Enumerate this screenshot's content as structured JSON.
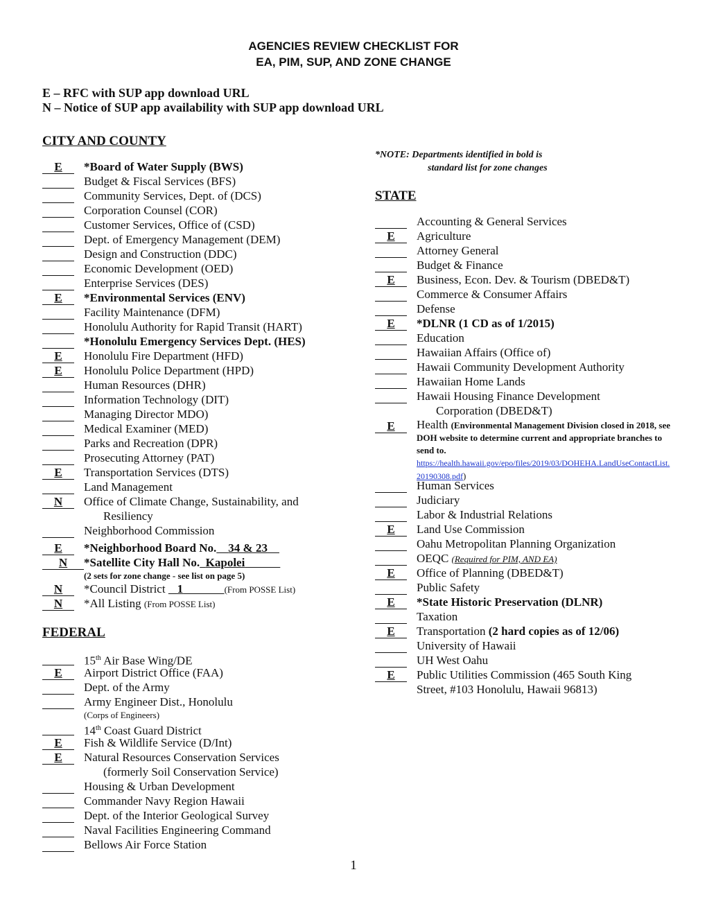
{
  "title": {
    "line1": "AGENCIES REVIEW CHECKLIST FOR",
    "line2": "EA, PIM, SUP, AND ZONE CHANGE"
  },
  "legend": {
    "e": "E – RFC with SUP app download URL",
    "n": "N – Notice of SUP app availability with SUP app download URL"
  },
  "note": {
    "line1": "*NOTE:  Departments identified in bold is",
    "line2": "standard list for zone changes"
  },
  "city_county": {
    "heading": "CITY AND COUNTY",
    "items": [
      {
        "mark": "E",
        "label": "*Board of Water Supply (BWS)",
        "bold": true
      },
      {
        "mark": "",
        "label": "Budget & Fiscal Services (BFS)"
      },
      {
        "mark": "",
        "label": "Community Services, Dept. of (DCS)"
      },
      {
        "mark": "",
        "label": "Corporation Counsel (COR)"
      },
      {
        "mark": "",
        "label": "Customer Services, Office of (CSD)"
      },
      {
        "mark": "",
        "label": "Dept. of Emergency Management (DEM)"
      },
      {
        "mark": "",
        "label": "Design and Construction (DDC)"
      },
      {
        "mark": "",
        "label": "Economic Development (OED)"
      },
      {
        "mark": "",
        "label": "Enterprise Services (DES)"
      },
      {
        "mark": "E",
        "label": "*Environmental Services (ENV)",
        "bold": true
      },
      {
        "mark": "",
        "label": "Facility Maintenance (DFM)"
      },
      {
        "mark": "",
        "label": "Honolulu Authority for Rapid Transit (HART)"
      },
      {
        "mark": "",
        "label": "*Honolulu Emergency Services Dept. (HES)",
        "bold": true
      },
      {
        "mark": "E",
        "label": "Honolulu Fire Department (HFD)"
      },
      {
        "mark": "E",
        "label": "Honolulu Police Department (HPD)"
      },
      {
        "mark": "",
        "label": "Human Resources (DHR)"
      },
      {
        "mark": "",
        "label": "Information Technology (DIT)"
      },
      {
        "mark": "",
        "label": "Managing Director MDO)"
      },
      {
        "mark": "",
        "label": "Medical Examiner (MED)"
      },
      {
        "mark": "",
        "label": "Parks and Recreation (DPR)"
      },
      {
        "mark": "",
        "label": "Prosecuting Attorney (PAT)"
      },
      {
        "mark": "E",
        "label": "Transportation Services (DTS)"
      },
      {
        "mark": "",
        "label": "Land Management"
      },
      {
        "mark": "N",
        "label": "Office of Climate Change, Sustainability, and",
        "cont": "Resiliency"
      },
      {
        "mark": "",
        "label": "Neighborhood Commission"
      }
    ],
    "neighborhood_board": {
      "mark": "E",
      "label": "*Neighborhood Board No.",
      "value": "34 & 23"
    },
    "satellite_city_hall": {
      "mark": "N",
      "label": "*Satellite City Hall No.",
      "value": "Kapolei",
      "note": "(2 sets for zone change - see list on page 5)"
    },
    "council_district": {
      "mark": "N",
      "label": "*Council District",
      "value": "1",
      "suffix": "(From POSSE List)"
    },
    "all_listing": {
      "mark": "N",
      "label": "*All Listing",
      "suffix": "(From POSSE List)"
    }
  },
  "federal": {
    "heading": "FEDERAL",
    "items": [
      {
        "mark": "",
        "label": "15",
        "sup": "th",
        "rest": " Air Base Wing/DE"
      },
      {
        "mark": "E",
        "label": "Airport District Office (FAA)"
      },
      {
        "mark": "",
        "label": "Dept. of the Army"
      },
      {
        "mark": "",
        "label": "Army Engineer Dist., Honolulu",
        "sub": "(Corps of Engineers)"
      },
      {
        "mark": "",
        "label": "14",
        "sup": "th",
        "rest": " Coast Guard District"
      },
      {
        "mark": "E",
        "label": "Fish & Wildlife Service (D/Int)"
      },
      {
        "mark": "E",
        "label": "Natural Resources Conservation Services",
        "cont": "(formerly Soil Conservation Service)"
      },
      {
        "mark": "",
        "label": "Housing & Urban Development"
      },
      {
        "mark": "",
        "label": "Commander Navy Region Hawaii"
      },
      {
        "mark": "",
        "label": "Dept. of the Interior Geological Survey"
      },
      {
        "mark": "",
        "label": "Naval Facilities Engineering Command"
      },
      {
        "mark": "",
        "label": "Bellows Air Force Station"
      }
    ]
  },
  "state": {
    "heading": "STATE",
    "items": [
      {
        "mark": "",
        "label": "Accounting & General Services"
      },
      {
        "mark": "E",
        "label": "Agriculture"
      },
      {
        "mark": "",
        "label": "Attorney General"
      },
      {
        "mark": "",
        "label": "Budget & Finance"
      },
      {
        "mark": "E",
        "label": "Business, Econ. Dev. & Tourism (DBED&T)"
      },
      {
        "mark": "",
        "label": "Commerce & Consumer Affairs"
      },
      {
        "mark": "",
        "label": "Defense"
      },
      {
        "mark": "E",
        "label": "*DLNR (1 CD as of 1/2015)",
        "bold": true
      },
      {
        "mark": "",
        "label": "Education"
      },
      {
        "mark": "",
        "label": "Hawaiian Affairs (Office of)"
      },
      {
        "mark": "",
        "label": "Hawaii Community Development Authority"
      },
      {
        "mark": "",
        "label": "Hawaiian Home Lands"
      },
      {
        "mark": "",
        "label": "Hawaii Housing Finance Development",
        "cont": "Corporation (DBED&T)"
      }
    ],
    "health": {
      "mark": "E",
      "label": "Health",
      "note": "(Environmental Management Division closed in 2018, see DOH website to determine current and appropriate branches to send to.",
      "link": "https://health.hawaii.gov/epo/files/2019/03/DOHEHA.LandUseContactList.20190308.pdf",
      "close": ")"
    },
    "items2": [
      {
        "mark": "",
        "label": "Human Services"
      },
      {
        "mark": "",
        "label": "Judiciary"
      },
      {
        "mark": "",
        "label": "Labor & Industrial Relations"
      },
      {
        "mark": "E",
        "label": "Land Use Commission"
      },
      {
        "mark": "",
        "label": "Oahu Metropolitan Planning Organization"
      }
    ],
    "oeqc": {
      "mark": "",
      "label": "OEQC",
      "note": "(Required for PIM, AND EA)"
    },
    "items3": [
      {
        "mark": "E",
        "label": "Office of Planning (DBED&T)"
      },
      {
        "mark": "",
        "label": "Public Safety"
      },
      {
        "mark": "E",
        "label": "*State Historic Preservation (DLNR)",
        "bold": true
      },
      {
        "mark": "",
        "label": "Taxation"
      }
    ],
    "transportation": {
      "mark": "E",
      "label": "Transportation",
      "note": "(2 hard copies as of 12/06)"
    },
    "items4": [
      {
        "mark": "",
        "label": "University of Hawaii"
      },
      {
        "mark": "",
        "label": "UH West Oahu"
      },
      {
        "mark": "E",
        "label": "Public Utilities Commission (465 South King",
        "cont": "Street, #103 Honolulu, Hawaii 96813)"
      }
    ]
  },
  "page_number": "1"
}
